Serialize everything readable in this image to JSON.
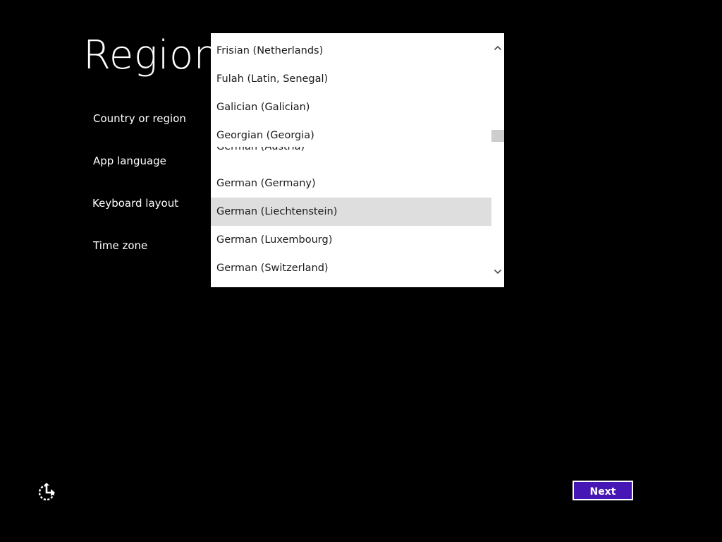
{
  "page": {
    "title": "Region"
  },
  "fields": {
    "country_label": "Country or region",
    "app_language_label": "App language",
    "keyboard_layout_label": "Keyboard layout",
    "time_zone_label": "Time zone"
  },
  "dropdown": {
    "items": [
      "Frisian (Netherlands)",
      "Fulah (Latin, Senegal)",
      "Galician (Galician)",
      "Georgian (Georgia)",
      "German (Austria)",
      "German (Germany)",
      "German (Liechtenstein)",
      "German (Luxembourg)",
      "German (Switzerland)"
    ],
    "selected": "German (Liechtenstein)"
  },
  "footer": {
    "next_label": "Next"
  },
  "icons": {
    "accessibility": "ease-of-access-icon",
    "scroll_up": "chevron-up-icon",
    "scroll_down": "chevron-down-icon"
  },
  "colors": {
    "background": "#000000",
    "next_button": "#4617b4",
    "list_background": "#ffffff",
    "selected_row": "#dedede",
    "scroll_thumb": "#cdcdcd"
  }
}
